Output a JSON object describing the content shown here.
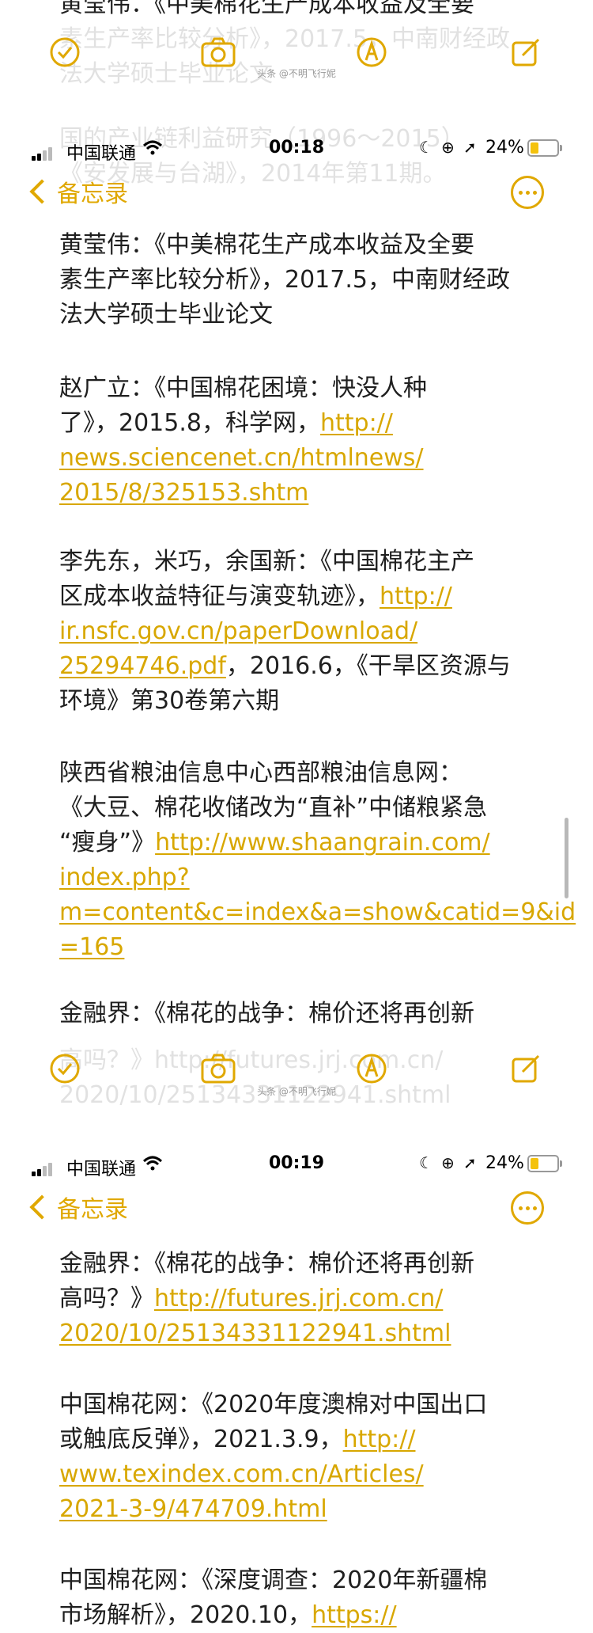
{
  "screen1": {
    "cut_text": [
      "黄莹伟：《中美棉花生产成本收益及全要",
      "素生产率比较分析》，2017.5，中南财经政",
      "法大学硕士毕业论文"
    ],
    "watermark": "头条 @不明飞行妮"
  },
  "screen2": {
    "status": {
      "carrier": "中国联通",
      "time": "00:18",
      "battery": "24%"
    },
    "nav": {
      "back_label": "备忘录"
    },
    "behind_text": [
      "国的产业链利益研究（1996～2015）",
      "《安发展与台湖》，2014年第11期。"
    ],
    "refs": [
      {
        "segments": [
          {
            "t": "黄莹伟：《中美棉花生产成本收益及全要"
          }
        ],
        "lines": [
          [
            {
              "t": "黄莹伟：《中美棉花生产成本收益及全要"
            }
          ],
          [
            {
              "t": "素生产率比较分析》，2017.5，中南财经政"
            }
          ],
          [
            {
              "t": "法大学硕士毕业论文"
            }
          ]
        ]
      },
      {
        "lines": [
          [
            {
              "t": "赵广立：《中国棉花困境：快没人种"
            }
          ],
          [
            {
              "t": "了》，2015.8，科学网，"
            },
            {
              "t": "http://",
              "link": true
            }
          ],
          [
            {
              "t": "news.sciencenet.cn/htmlnews/",
              "link": true
            }
          ],
          [
            {
              "t": "2015/8/325153.shtm",
              "link": true
            }
          ]
        ]
      },
      {
        "lines": [
          [
            {
              "t": "李先东，米巧，余国新：《中国棉花主产"
            }
          ],
          [
            {
              "t": "区成本收益特征与演变轨迹》，"
            },
            {
              "t": "http://",
              "link": true
            }
          ],
          [
            {
              "t": "ir.nsfc.gov.cn/paperDownload/",
              "link": true
            }
          ],
          [
            {
              "t": "25294746.pdf",
              "link": true
            },
            {
              "t": "，2016.6，《干旱区资源与"
            }
          ],
          [
            {
              "t": "环境》第30卷第六期"
            }
          ]
        ]
      },
      {
        "lines": [
          [
            {
              "t": "陕西省粮油信息中心西部粮油信息网："
            }
          ],
          [
            {
              "t": "《大豆、棉花收储改为“直补”中储粮紧急"
            }
          ],
          [
            {
              "t": "“瘦身”》"
            },
            {
              "t": "http://www.shaangrain.com/",
              "link": true
            }
          ],
          [
            {
              "t": "index.php?",
              "link": true
            }
          ],
          [
            {
              "t": "m=content&c=index&a=show&catid=9&id",
              "link": true
            }
          ],
          [
            {
              "t": "=165",
              "link": true
            }
          ]
        ]
      },
      {
        "lines": [
          [
            {
              "t": "金融界：《棉花的战争：棉价还将再创新"
            }
          ]
        ]
      }
    ],
    "faded_under_toolbar": [
      "高吗？》http://futures.jrj.com.cn/",
      "2020/10/25134331122941.shtml"
    ],
    "watermark": "头条 @不明飞行妮"
  },
  "screen3": {
    "status": {
      "carrier": "中国联通",
      "time": "00:19",
      "battery": "24%"
    },
    "nav": {
      "back_label": "备忘录"
    },
    "refs": [
      {
        "lines": [
          [
            {
              "t": "金融界：《棉花的战争：棉价还将再创新"
            }
          ],
          [
            {
              "t": "高吗？》"
            },
            {
              "t": "http://futures.jrj.com.cn/",
              "link": true
            }
          ],
          [
            {
              "t": "2020/10/25134331122941.shtml",
              "link": true
            }
          ]
        ]
      },
      {
        "lines": [
          [
            {
              "t": "中国棉花网：《2020年度澳棉对中国出口"
            }
          ],
          [
            {
              "t": "或触底反弹》，2021.3.9，"
            },
            {
              "t": "http://",
              "link": true
            }
          ],
          [
            {
              "t": "www.texindex.com.cn/Articles/",
              "link": true
            }
          ],
          [
            {
              "t": "2021-3-9/474709.html",
              "link": true
            }
          ]
        ]
      },
      {
        "lines": [
          [
            {
              "t": "中国棉花网：《深度调查：2020年新疆棉"
            }
          ],
          [
            {
              "t": "市场解析》，2020.10，"
            },
            {
              "t": "https://",
              "link": true
            }
          ]
        ]
      }
    ]
  },
  "colors": {
    "accent": "#e0a800",
    "link": "#d8a700",
    "text": "#1f1f1f"
  },
  "icons": [
    "checklist-icon",
    "camera-icon",
    "markup-icon",
    "compose-icon",
    "more-icon",
    "back-chevron-icon",
    "wifi-icon",
    "moon-icon",
    "location-icon",
    "rotation-lock-icon"
  ]
}
